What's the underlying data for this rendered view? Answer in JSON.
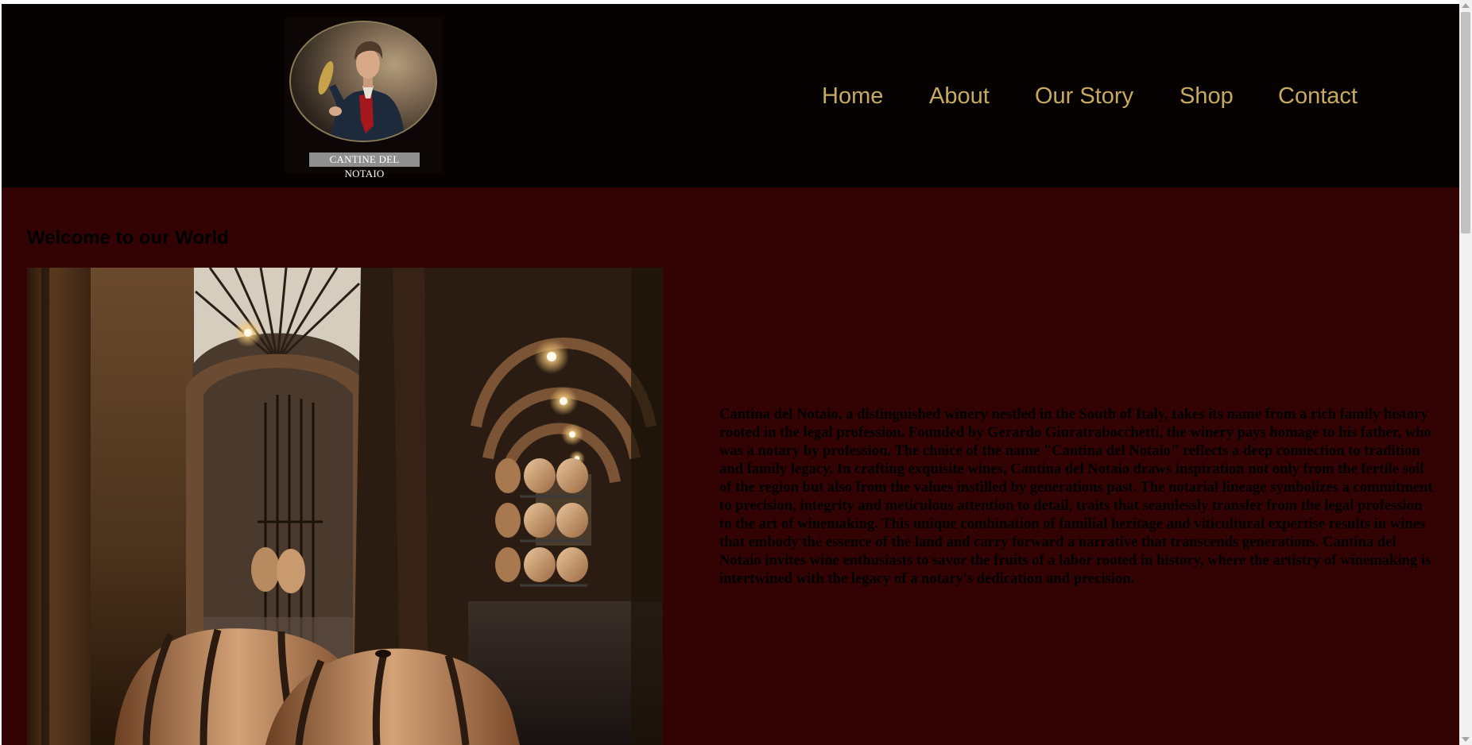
{
  "header": {
    "logo_caption": "CANTINE DEL NOTAIO",
    "nav": [
      {
        "label": "Home"
      },
      {
        "label": "About"
      },
      {
        "label": "Our Story"
      },
      {
        "label": "Shop"
      },
      {
        "label": "Contact"
      }
    ],
    "nav_color": "#c6aa63",
    "background": "#070202"
  },
  "main": {
    "background": "#330304",
    "heading": "Welcome to our World",
    "story": "Cantina del Notaio, a distinguished winery nestled in the South of Italy, takes its name from a rich family history rooted in the legal profession. Founded by Gerardo Giuratrabocchetti, the winery pays homage to his father, who was a notary by profession. The choice of the name \"Cantina del Notaio\" reflects a deep connection to tradition and family legacy. In crafting exquisite wines, Cantina del Notaio draws inspiration not only from the fertile soil of the region but also from the values instilled by generations past. The notarial lineage symbolizes a commitment to precision, integrity and meticulous attention to detail, traits that seamlessly transfer from the legal profession to the art of winemaking. This unique combination of familial heritage and viticultural expertise results in wines that embody the essence of the land and carry forward a narrative that transcends generations. Cantina del Notaio invites wine enthusiasts to savor the fruits of a labor rooted in history, where the artistry of winemaking is intertwined with the legacy of a notary's dedication and precision."
  },
  "images": {
    "logo_icon": "portrait-logo-icon",
    "hero_image": "wine-cellar-photo"
  }
}
